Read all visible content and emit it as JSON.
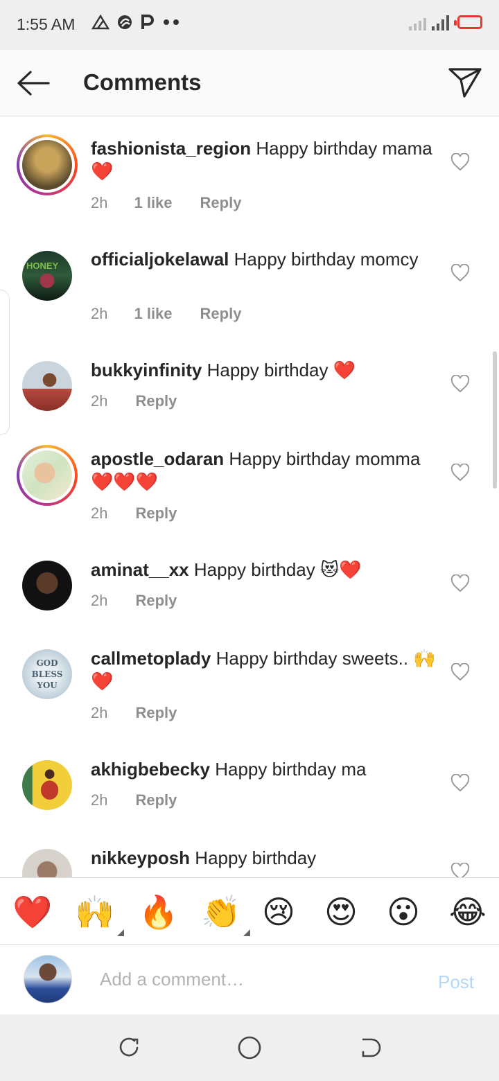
{
  "status_bar": {
    "time": "1:55 AM",
    "notification_icons": [
      "triangle-icon",
      "swirl-icon",
      "p-icon",
      "more-dots-icon"
    ]
  },
  "header": {
    "title": "Comments",
    "back_icon": "arrow-left-icon",
    "send_icon": "paper-plane-icon"
  },
  "comments": [
    {
      "username": "fashionista_region",
      "text": "Happy birthday mama❤️",
      "time": "2h",
      "likes": "1 like",
      "reply": "Reply",
      "story_ring": true,
      "avatar_colors": [
        "#5a4a2e",
        "#c8a35a"
      ]
    },
    {
      "username": "officialjokelawal",
      "text": "Happy birthday momcy",
      "time": "2h",
      "likes": "1 like",
      "reply": "Reply",
      "story_ring": false,
      "avatar_colors": [
        "#1d3a2a",
        "#7cc043"
      ]
    },
    {
      "username": "bukkyinfinity",
      "text": "Happy birthday ❤️",
      "time": "2h",
      "likes": "",
      "reply": "Reply",
      "story_ring": false,
      "avatar_colors": [
        "#c9d4dd",
        "#b34a3f"
      ]
    },
    {
      "username": "apostle_odaran",
      "text": "Happy birthday momma❤️❤️❤️",
      "time": "2h",
      "likes": "",
      "reply": "Reply",
      "story_ring": true,
      "avatar_colors": [
        "#cfe3c0",
        "#e8c39e"
      ]
    },
    {
      "username": "aminat__xx",
      "text": "Happy birthday 😻❤️",
      "time": "2h",
      "likes": "",
      "reply": "Reply",
      "story_ring": false,
      "avatar_colors": [
        "#111111",
        "#5a3b2a"
      ]
    },
    {
      "username": "callmetoplady",
      "text": "Happy birthday sweets.. 🙌❤️",
      "time": "2h",
      "likes": "",
      "reply": "Reply",
      "story_ring": false,
      "avatar_colors": [
        "#9fb8c8",
        "#e8eef2"
      ],
      "avatar_text": "GOD BLESS YOU"
    },
    {
      "username": "akhigbebecky",
      "text": "Happy birthday ma",
      "time": "2h",
      "likes": "",
      "reply": "Reply",
      "story_ring": false,
      "avatar_colors": [
        "#f2cf3a",
        "#c0392b"
      ]
    },
    {
      "username": "nikkeyposh",
      "text": "Happy birthday",
      "time": "",
      "likes": "",
      "reply": "",
      "story_ring": false,
      "avatar_colors": [
        "#d8d2cc",
        "#9a7a66"
      ]
    }
  ],
  "emoji_bar": [
    "❤️",
    "🙌",
    "🔥",
    "👏",
    "😢",
    "😍",
    "😮",
    "😂"
  ],
  "comment_input": {
    "placeholder": "Add a comment…",
    "post_label": "Post"
  },
  "nav_bar": {
    "buttons": [
      "recent-apps-icon",
      "home-icon",
      "back-icon"
    ]
  }
}
